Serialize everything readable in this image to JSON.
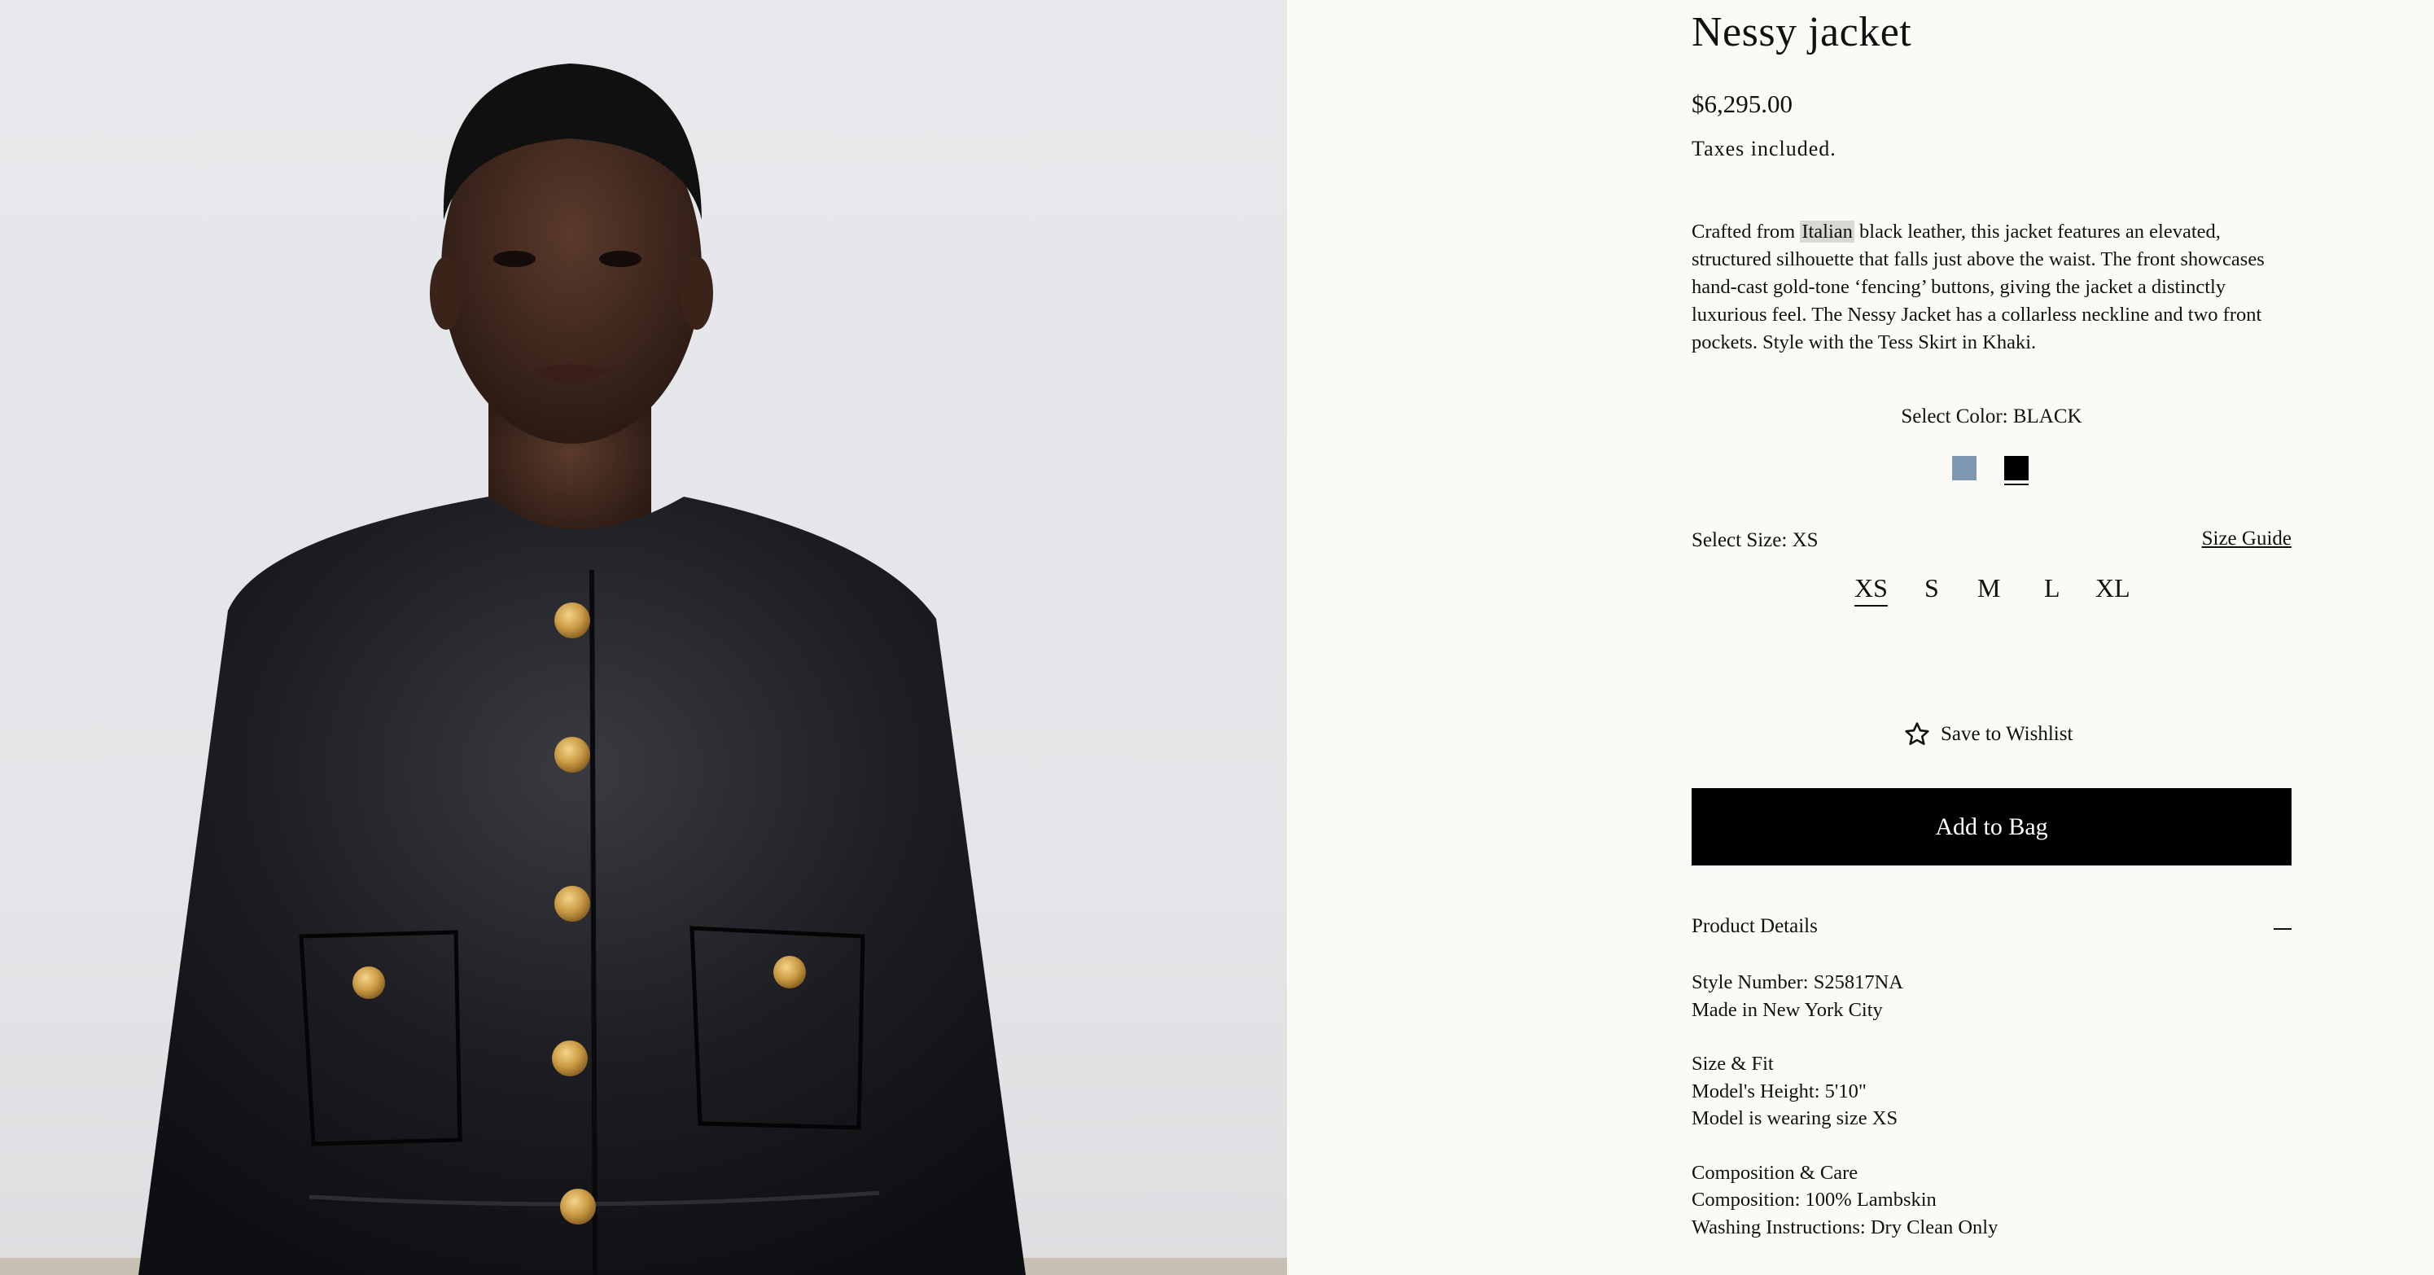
{
  "product": {
    "title": "Nessy jacket",
    "price": "$6,295.00",
    "taxes_note": "Taxes included.",
    "description_pre": "Crafted from ",
    "description_highlight": "Italian",
    "description_post": " black leather, this jacket features an elevated, structured silhouette that falls just above the waist. The front showcases hand-cast gold-tone ‘fencing’ buttons, giving the jacket a distinctly luxurious feel. The Nessy Jacket has a collarless neckline and two front pockets. Style with the Tess Skirt in Khaki."
  },
  "color": {
    "label": "Select Color: BLACK",
    "swatches": [
      {
        "name": "Blue",
        "hex": "#7f98b2"
      },
      {
        "name": "BLACK",
        "hex": "#000000",
        "selected": true
      }
    ]
  },
  "size": {
    "label": "Select Size: XS",
    "guide_label": "Size Guide",
    "options": [
      "XS",
      "S",
      "M",
      "L",
      "XL"
    ],
    "selected": "XS"
  },
  "actions": {
    "wishlist_label": "Save to Wishlist",
    "wishlist_icon": "star-outline-icon",
    "add_to_bag_label": "Add to Bag"
  },
  "details": {
    "header": "Product Details",
    "toggle_icon": "minus-icon",
    "style_number": "Style Number: S25817NA",
    "made_in": "Made in New York City",
    "size_fit_title": "Size & Fit",
    "model_height": "Model's Height: 5'10\"",
    "model_size": "Model is wearing size XS",
    "composition_title": "Composition & Care",
    "composition": "Composition: 100% Lambskin",
    "washing": "Washing Instructions: Dry Clean Only"
  }
}
